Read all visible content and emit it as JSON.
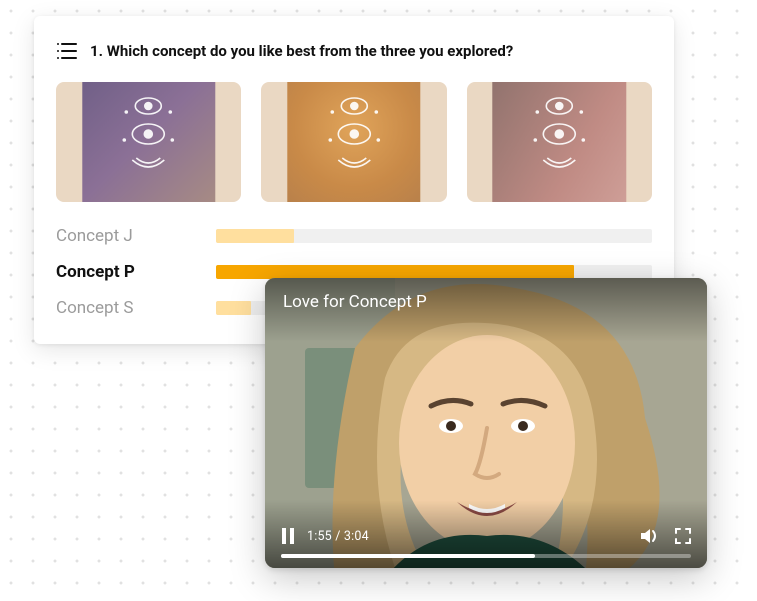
{
  "question": {
    "number": "1.",
    "text": "Which concept do you like best from the three you explored?"
  },
  "concepts": [
    {
      "id": "J",
      "label": "Concept J",
      "value": 18,
      "selected": false,
      "bar_color": "#ffdf9e",
      "pouch_class": "j"
    },
    {
      "id": "P",
      "label": "Concept P",
      "value": 82,
      "selected": true,
      "bar_color": "#f7a600",
      "pouch_class": "p"
    },
    {
      "id": "S",
      "label": "Concept S",
      "value": 8,
      "selected": false,
      "bar_color": "#ffdf9e",
      "pouch_class": "s"
    }
  ],
  "chart_data": {
    "type": "bar",
    "orientation": "horizontal",
    "categories": [
      "Concept J",
      "Concept P",
      "Concept S"
    ],
    "values": [
      18,
      82,
      8
    ],
    "highlighted": "Concept P",
    "xlim": [
      0,
      100
    ],
    "colors": {
      "default": "#ffdf9e",
      "highlighted": "#f7a600",
      "track": "#f0f0f0"
    }
  },
  "video": {
    "title": "Love for Concept P",
    "current_time": "1:55",
    "duration": "3:04",
    "progress_pct": 62
  }
}
